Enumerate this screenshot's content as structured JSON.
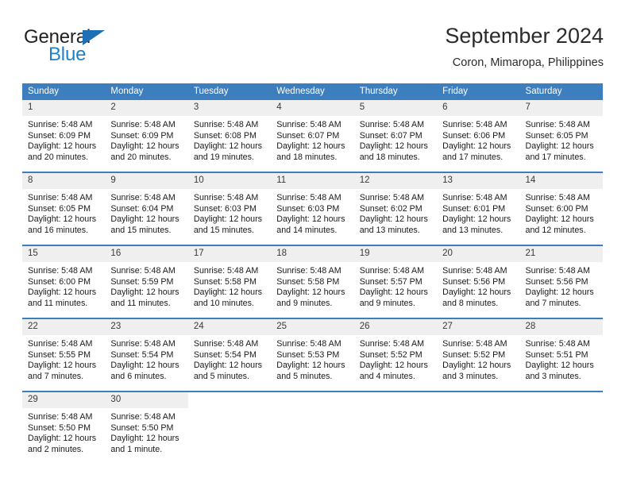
{
  "brand": {
    "name_top": "General",
    "name_bottom": "Blue"
  },
  "header": {
    "title": "September 2024",
    "subtitle": "Coron, Mimaropa, Philippines"
  },
  "colors": {
    "header_blue": "#3d7ebf",
    "brand_blue": "#2081c8",
    "daynum_bg": "#efefef"
  },
  "weekdays": [
    "Sunday",
    "Monday",
    "Tuesday",
    "Wednesday",
    "Thursday",
    "Friday",
    "Saturday"
  ],
  "weeks": [
    [
      {
        "day": "1",
        "sunrise": "Sunrise: 5:48 AM",
        "sunset": "Sunset: 6:09 PM",
        "daylight_line1": "Daylight: 12 hours",
        "daylight_line2": "and 20 minutes."
      },
      {
        "day": "2",
        "sunrise": "Sunrise: 5:48 AM",
        "sunset": "Sunset: 6:09 PM",
        "daylight_line1": "Daylight: 12 hours",
        "daylight_line2": "and 20 minutes."
      },
      {
        "day": "3",
        "sunrise": "Sunrise: 5:48 AM",
        "sunset": "Sunset: 6:08 PM",
        "daylight_line1": "Daylight: 12 hours",
        "daylight_line2": "and 19 minutes."
      },
      {
        "day": "4",
        "sunrise": "Sunrise: 5:48 AM",
        "sunset": "Sunset: 6:07 PM",
        "daylight_line1": "Daylight: 12 hours",
        "daylight_line2": "and 18 minutes."
      },
      {
        "day": "5",
        "sunrise": "Sunrise: 5:48 AM",
        "sunset": "Sunset: 6:07 PM",
        "daylight_line1": "Daylight: 12 hours",
        "daylight_line2": "and 18 minutes."
      },
      {
        "day": "6",
        "sunrise": "Sunrise: 5:48 AM",
        "sunset": "Sunset: 6:06 PM",
        "daylight_line1": "Daylight: 12 hours",
        "daylight_line2": "and 17 minutes."
      },
      {
        "day": "7",
        "sunrise": "Sunrise: 5:48 AM",
        "sunset": "Sunset: 6:05 PM",
        "daylight_line1": "Daylight: 12 hours",
        "daylight_line2": "and 17 minutes."
      }
    ],
    [
      {
        "day": "8",
        "sunrise": "Sunrise: 5:48 AM",
        "sunset": "Sunset: 6:05 PM",
        "daylight_line1": "Daylight: 12 hours",
        "daylight_line2": "and 16 minutes."
      },
      {
        "day": "9",
        "sunrise": "Sunrise: 5:48 AM",
        "sunset": "Sunset: 6:04 PM",
        "daylight_line1": "Daylight: 12 hours",
        "daylight_line2": "and 15 minutes."
      },
      {
        "day": "10",
        "sunrise": "Sunrise: 5:48 AM",
        "sunset": "Sunset: 6:03 PM",
        "daylight_line1": "Daylight: 12 hours",
        "daylight_line2": "and 15 minutes."
      },
      {
        "day": "11",
        "sunrise": "Sunrise: 5:48 AM",
        "sunset": "Sunset: 6:03 PM",
        "daylight_line1": "Daylight: 12 hours",
        "daylight_line2": "and 14 minutes."
      },
      {
        "day": "12",
        "sunrise": "Sunrise: 5:48 AM",
        "sunset": "Sunset: 6:02 PM",
        "daylight_line1": "Daylight: 12 hours",
        "daylight_line2": "and 13 minutes."
      },
      {
        "day": "13",
        "sunrise": "Sunrise: 5:48 AM",
        "sunset": "Sunset: 6:01 PM",
        "daylight_line1": "Daylight: 12 hours",
        "daylight_line2": "and 13 minutes."
      },
      {
        "day": "14",
        "sunrise": "Sunrise: 5:48 AM",
        "sunset": "Sunset: 6:00 PM",
        "daylight_line1": "Daylight: 12 hours",
        "daylight_line2": "and 12 minutes."
      }
    ],
    [
      {
        "day": "15",
        "sunrise": "Sunrise: 5:48 AM",
        "sunset": "Sunset: 6:00 PM",
        "daylight_line1": "Daylight: 12 hours",
        "daylight_line2": "and 11 minutes."
      },
      {
        "day": "16",
        "sunrise": "Sunrise: 5:48 AM",
        "sunset": "Sunset: 5:59 PM",
        "daylight_line1": "Daylight: 12 hours",
        "daylight_line2": "and 11 minutes."
      },
      {
        "day": "17",
        "sunrise": "Sunrise: 5:48 AM",
        "sunset": "Sunset: 5:58 PM",
        "daylight_line1": "Daylight: 12 hours",
        "daylight_line2": "and 10 minutes."
      },
      {
        "day": "18",
        "sunrise": "Sunrise: 5:48 AM",
        "sunset": "Sunset: 5:58 PM",
        "daylight_line1": "Daylight: 12 hours",
        "daylight_line2": "and 9 minutes."
      },
      {
        "day": "19",
        "sunrise": "Sunrise: 5:48 AM",
        "sunset": "Sunset: 5:57 PM",
        "daylight_line1": "Daylight: 12 hours",
        "daylight_line2": "and 9 minutes."
      },
      {
        "day": "20",
        "sunrise": "Sunrise: 5:48 AM",
        "sunset": "Sunset: 5:56 PM",
        "daylight_line1": "Daylight: 12 hours",
        "daylight_line2": "and 8 minutes."
      },
      {
        "day": "21",
        "sunrise": "Sunrise: 5:48 AM",
        "sunset": "Sunset: 5:56 PM",
        "daylight_line1": "Daylight: 12 hours",
        "daylight_line2": "and 7 minutes."
      }
    ],
    [
      {
        "day": "22",
        "sunrise": "Sunrise: 5:48 AM",
        "sunset": "Sunset: 5:55 PM",
        "daylight_line1": "Daylight: 12 hours",
        "daylight_line2": "and 7 minutes."
      },
      {
        "day": "23",
        "sunrise": "Sunrise: 5:48 AM",
        "sunset": "Sunset: 5:54 PM",
        "daylight_line1": "Daylight: 12 hours",
        "daylight_line2": "and 6 minutes."
      },
      {
        "day": "24",
        "sunrise": "Sunrise: 5:48 AM",
        "sunset": "Sunset: 5:54 PM",
        "daylight_line1": "Daylight: 12 hours",
        "daylight_line2": "and 5 minutes."
      },
      {
        "day": "25",
        "sunrise": "Sunrise: 5:48 AM",
        "sunset": "Sunset: 5:53 PM",
        "daylight_line1": "Daylight: 12 hours",
        "daylight_line2": "and 5 minutes."
      },
      {
        "day": "26",
        "sunrise": "Sunrise: 5:48 AM",
        "sunset": "Sunset: 5:52 PM",
        "daylight_line1": "Daylight: 12 hours",
        "daylight_line2": "and 4 minutes."
      },
      {
        "day": "27",
        "sunrise": "Sunrise: 5:48 AM",
        "sunset": "Sunset: 5:52 PM",
        "daylight_line1": "Daylight: 12 hours",
        "daylight_line2": "and 3 minutes."
      },
      {
        "day": "28",
        "sunrise": "Sunrise: 5:48 AM",
        "sunset": "Sunset: 5:51 PM",
        "daylight_line1": "Daylight: 12 hours",
        "daylight_line2": "and 3 minutes."
      }
    ],
    [
      {
        "day": "29",
        "sunrise": "Sunrise: 5:48 AM",
        "sunset": "Sunset: 5:50 PM",
        "daylight_line1": "Daylight: 12 hours",
        "daylight_line2": "and 2 minutes."
      },
      {
        "day": "30",
        "sunrise": "Sunrise: 5:48 AM",
        "sunset": "Sunset: 5:50 PM",
        "daylight_line1": "Daylight: 12 hours",
        "daylight_line2": "and 1 minute."
      },
      {
        "day": "",
        "sunrise": "",
        "sunset": "",
        "daylight_line1": "",
        "daylight_line2": ""
      },
      {
        "day": "",
        "sunrise": "",
        "sunset": "",
        "daylight_line1": "",
        "daylight_line2": ""
      },
      {
        "day": "",
        "sunrise": "",
        "sunset": "",
        "daylight_line1": "",
        "daylight_line2": ""
      },
      {
        "day": "",
        "sunrise": "",
        "sunset": "",
        "daylight_line1": "",
        "daylight_line2": ""
      },
      {
        "day": "",
        "sunrise": "",
        "sunset": "",
        "daylight_line1": "",
        "daylight_line2": ""
      }
    ]
  ]
}
